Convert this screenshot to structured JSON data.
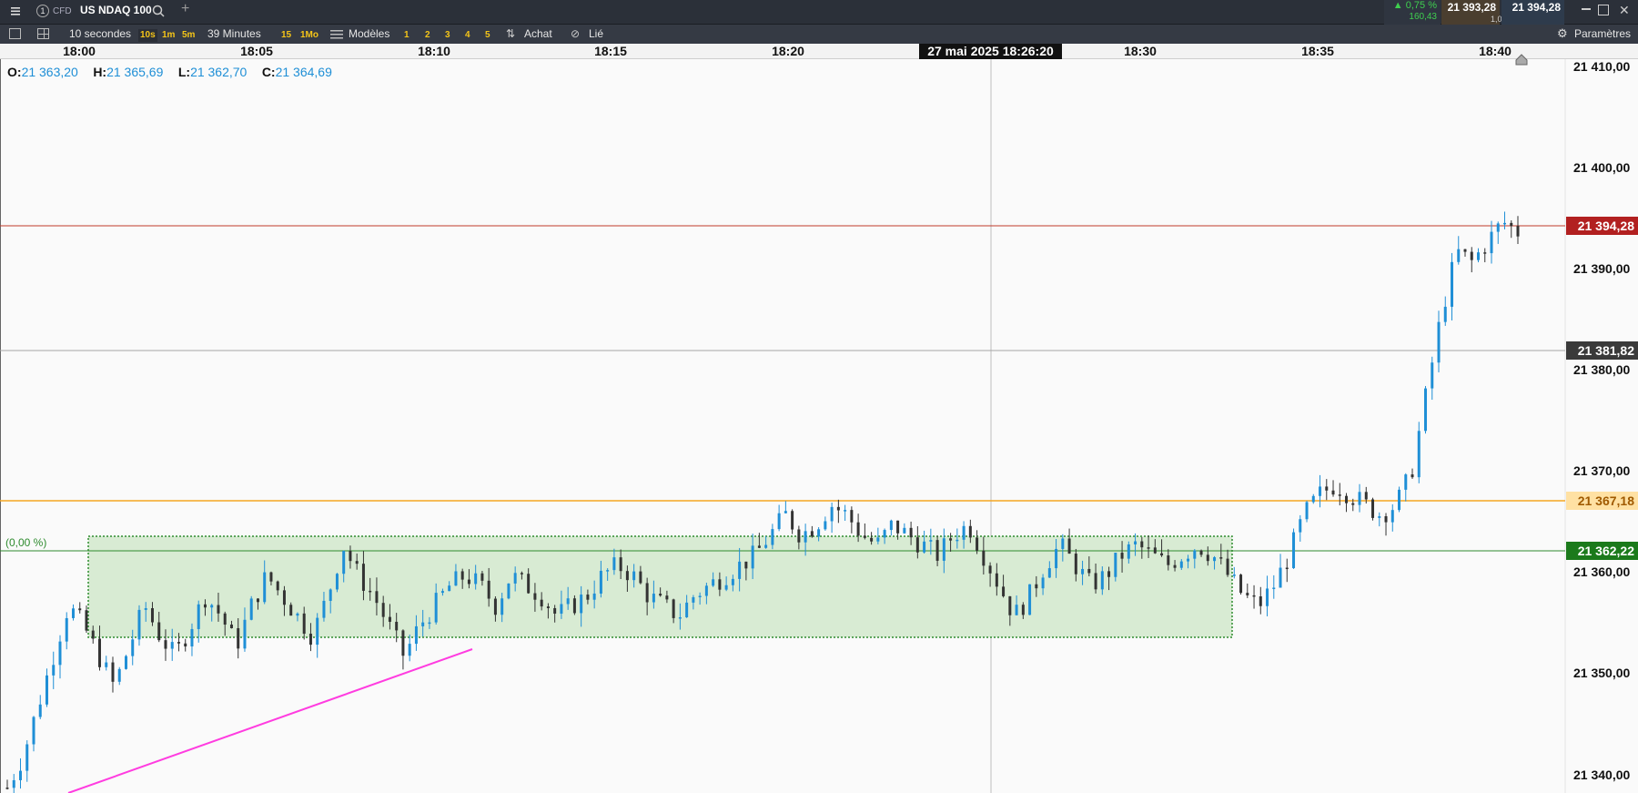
{
  "header": {
    "info_badge": "1",
    "instrument_type": "CFD",
    "instrument_name": "US NDAQ 100",
    "add_tab": "+",
    "change_pct": "▲ 0,75 %",
    "change_pts": "160,43",
    "bid": "21 393,28",
    "spread": "1,00",
    "ask": "21 394,28"
  },
  "toolbar": {
    "interval": "10 secondes",
    "quick_10s": "10s",
    "quick_1m": "1m",
    "quick_5m": "5m",
    "range": "39 Minutes",
    "quick_15": "15",
    "quick_1mo": "1Mo",
    "templates": "Modèles",
    "link_1": "1",
    "link_2": "2",
    "link_3": "3",
    "link_4": "4",
    "link_5": "5",
    "buy": "Achat",
    "linked": "Lié",
    "settings": "Paramètres"
  },
  "time_axis": {
    "ticks": [
      "18:00",
      "18:05",
      "18:10",
      "18:15",
      "18:20",
      "18:30",
      "18:35",
      "18:40"
    ],
    "crosshair_label": "27 mai 2025 18:26:20"
  },
  "ohlc": {
    "o_label": "O:",
    "o_value": "21 363,20",
    "h_label": "H:",
    "h_value": "21 365,69",
    "l_label": "L:",
    "l_value": "21 362,70",
    "c_label": "C:",
    "c_value": "21 364,69"
  },
  "zone_label": "(0,00 %)",
  "price_axis": {
    "labels": [
      "21 410,00",
      "21 400,00",
      "21 390,00",
      "21 380,00",
      "21 370,00",
      "21 360,00",
      "21 350,00",
      "21 340,00"
    ]
  },
  "levels": {
    "current": "21 394,28",
    "crosshair": "21 381,82",
    "orange": "21 367,18",
    "green": "21 362,22"
  },
  "colors": {
    "up": "#1f8fd6",
    "down": "#333333",
    "current_line": "#c0392b",
    "orange_line": "#f5a623",
    "green_line": "#2e8b2e",
    "trend_line": "#ff3ce0",
    "zone_fill": "#d8ebd3"
  },
  "chart_data": {
    "type": "candlestick",
    "interval": "10 secondes",
    "y_range": [
      21338,
      21414
    ],
    "x_range": [
      "18:00",
      "18:40"
    ],
    "close_path": [
      21339,
      21342,
      21347,
      21352,
      21357,
      21355,
      21352,
      21349,
      21353,
      21357,
      21354,
      21352,
      21355,
      21358,
      21356,
      21353,
      21357,
      21360,
      21358,
      21356,
      21354,
      21358,
      21363,
      21360,
      21358,
      21355,
      21352,
      21355,
      21357,
      21359,
      21360,
      21359,
      21357,
      21360,
      21359,
      21358,
      21356,
      21357,
      21358,
      21360,
      21361,
      21360,
      21358,
      21357,
      21356,
      21358,
      21359,
      21360,
      21361,
      21362,
      21364,
      21366,
      21364,
      21365,
      21367,
      21366,
      21364,
      21363,
      21365,
      21364,
      21363,
      21362,
      21364,
      21365,
      21362,
      21359,
      21356,
      21358,
      21361,
      21363,
      21361,
      21359,
      21360,
      21362,
      21363,
      21362,
      21361,
      21362,
      21363,
      21362,
      21360,
      21358,
      21357,
      21359,
      21362,
      21366,
      21368,
      21369,
      21368,
      21367,
      21366,
      21367,
      21370,
      21378,
      21386,
      21392,
      21391,
      21393,
      21395,
      21394
    ]
  }
}
